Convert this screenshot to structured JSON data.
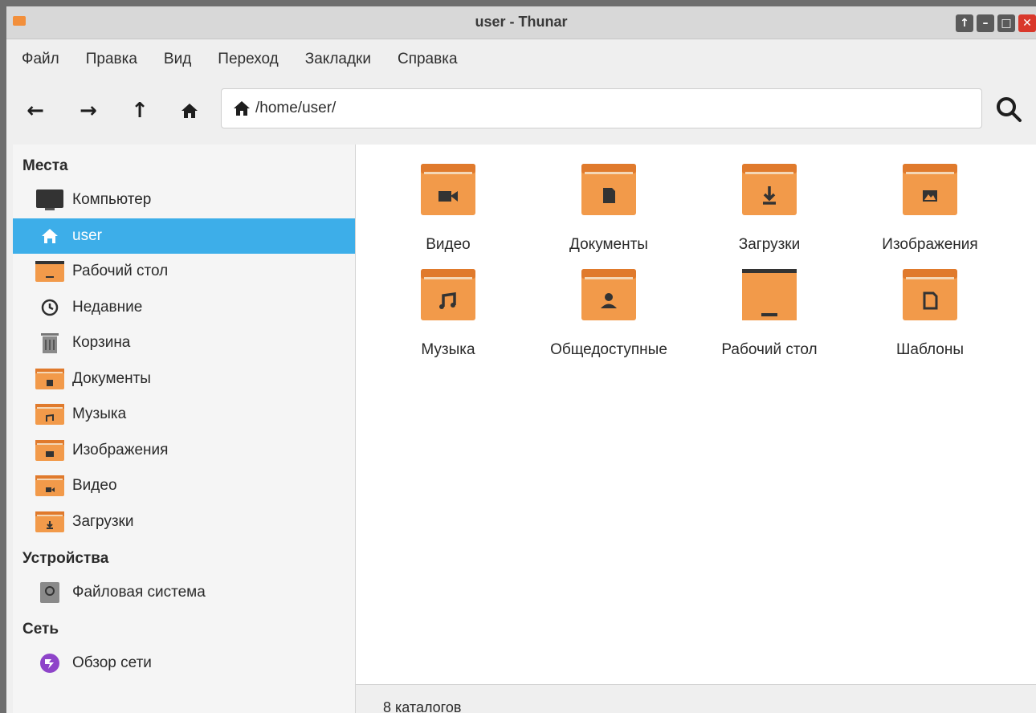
{
  "window": {
    "title": "user - Thunar"
  },
  "window_buttons": [
    "↑",
    "–",
    "□",
    "✕"
  ],
  "menu": [
    "Файл",
    "Правка",
    "Вид",
    "Переход",
    "Закладки",
    "Справка"
  ],
  "toolbar": {
    "path": "/home/user/"
  },
  "sidebar": {
    "places_title": "Места",
    "places": [
      {
        "label": "Компьютер",
        "icon": "computer-icon"
      },
      {
        "label": "user",
        "icon": "home-icon",
        "active": true
      },
      {
        "label": "Рабочий стол",
        "icon": "desktop-folder-icon"
      },
      {
        "label": "Недавние",
        "icon": "clock-icon"
      },
      {
        "label": "Корзина",
        "icon": "trash-icon"
      },
      {
        "label": "Документы",
        "icon": "documents-folder-icon"
      },
      {
        "label": "Музыка",
        "icon": "music-folder-icon"
      },
      {
        "label": "Изображения",
        "icon": "pictures-folder-icon"
      },
      {
        "label": "Видео",
        "icon": "video-folder-icon"
      },
      {
        "label": "Загрузки",
        "icon": "downloads-folder-icon"
      }
    ],
    "devices_title": "Устройства",
    "devices": [
      {
        "label": "Файловая система",
        "icon": "drive-icon"
      }
    ],
    "network_title": "Сеть",
    "network": [
      {
        "label": "Обзор сети",
        "icon": "network-icon"
      }
    ]
  },
  "files": [
    {
      "label": "Видео",
      "icon": "video-folder-icon"
    },
    {
      "label": "Документы",
      "icon": "documents-folder-icon"
    },
    {
      "label": "Загрузки",
      "icon": "downloads-folder-icon"
    },
    {
      "label": "Изображения",
      "icon": "pictures-folder-icon"
    },
    {
      "label": "Музыка",
      "icon": "music-folder-icon"
    },
    {
      "label": "Общедоступные",
      "icon": "public-folder-icon"
    },
    {
      "label": "Рабочий стол",
      "icon": "desktop-folder-icon"
    },
    {
      "label": "Шаблоны",
      "icon": "templates-folder-icon"
    }
  ],
  "status": {
    "text": "8 каталогов"
  },
  "colors": {
    "accent": "#3daee9",
    "folder": "#f28f3b",
    "folder_dark": "#e0772a"
  }
}
